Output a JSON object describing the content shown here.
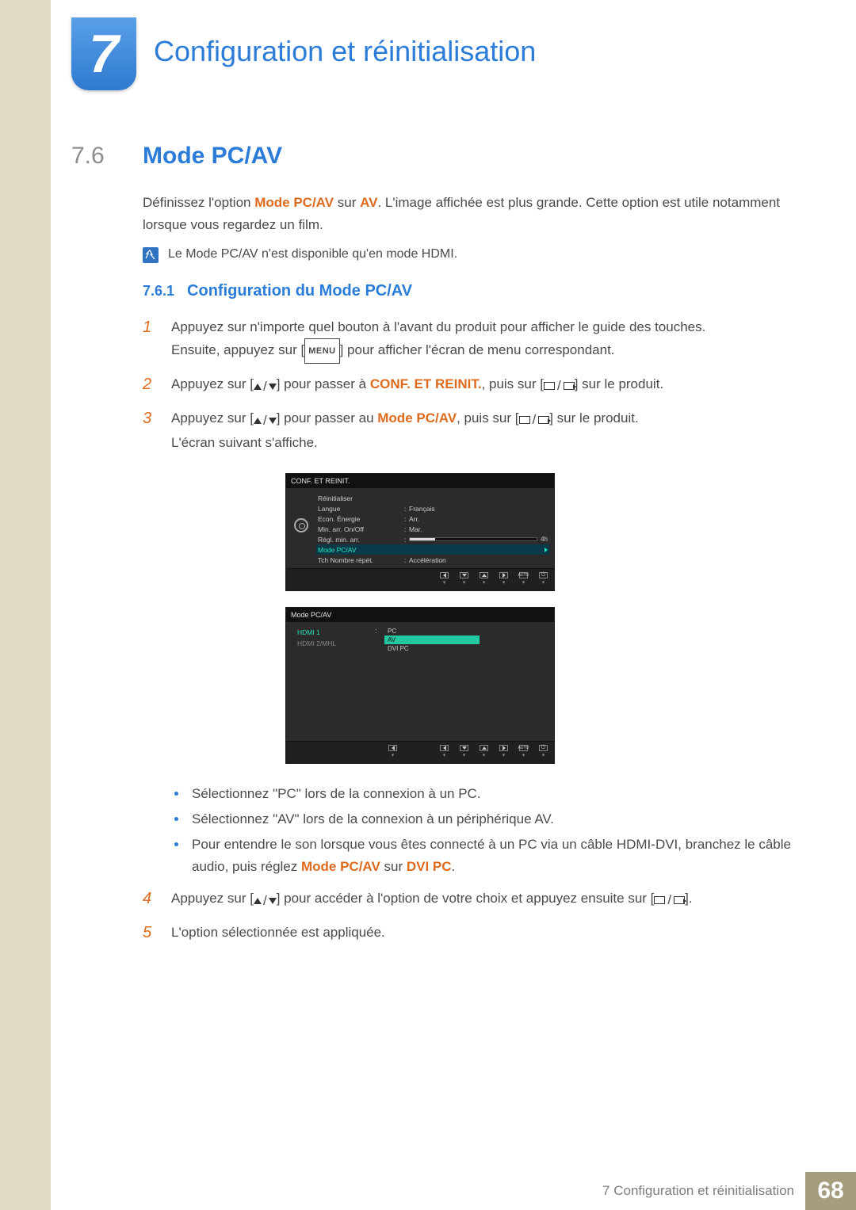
{
  "chapter": {
    "number": "7",
    "title": "Configuration et réinitialisation"
  },
  "section": {
    "number": "7.6",
    "title": "Mode PC/AV"
  },
  "para1": {
    "pre": "Définissez l'option ",
    "opt": "Mode PC/AV",
    "mid": " sur ",
    "val": "AV",
    "post": ". L'image affichée est plus grande. Cette option est utile notamment lorsque vous regardez un film."
  },
  "note1": {
    "pre": "Le ",
    "opt": "Mode PC/AV",
    "mid": " n'est disponible qu'en mode ",
    "val": "HDMI",
    "post": "."
  },
  "subsection": {
    "number": "7.6.1",
    "title": "Configuration du Mode PC/AV"
  },
  "steps": {
    "s1a": "Appuyez sur n'importe quel bouton à l'avant du produit pour afficher le guide des touches.",
    "s1b_pre": "Ensuite, appuyez sur [",
    "s1b_menu": "MENU",
    "s1b_post": "] pour afficher l'écran de menu correspondant.",
    "s2_pre": "Appuyez sur [",
    "s2_mid1": "] pour passer à ",
    "s2_conf": "CONF. ET REINIT.",
    "s2_mid2": ", puis sur [",
    "s2_post": "] sur le produit.",
    "s3_pre": "Appuyez sur [",
    "s3_mid1": "] pour passer au ",
    "s3_mode": "Mode PC/AV",
    "s3_mid2": ", puis sur [",
    "s3_post": "] sur le produit.",
    "s3_after": "L'écran suivant s'affiche.",
    "s4_pre": "Appuyez sur [",
    "s4_mid": "] pour accéder à l'option de votre choix et appuyez ensuite sur [",
    "s4_post": "].",
    "s5": "L'option sélectionnée est appliquée."
  },
  "bullets": {
    "b1": "Sélectionnez \"PC\" lors de la connexion à un PC.",
    "b2": "Sélectionnez \"AV\" lors de la connexion à un périphérique AV.",
    "b3_pre": "Pour entendre le son lorsque vous êtes connecté à un PC via un câble HDMI-DVI, branchez le câble audio, puis réglez ",
    "b3_mode": "Mode PC/AV",
    "b3_mid": " sur ",
    "b3_val": "DVI PC",
    "b3_post": "."
  },
  "osd1": {
    "title": "CONF. ET REINIT.",
    "rows": [
      {
        "lbl": "Réinitialiser",
        "val": ""
      },
      {
        "lbl": "Langue",
        "val": "Français"
      },
      {
        "lbl": "Econ. Énergie",
        "val": "Arr."
      },
      {
        "lbl": "Min. arr. On/Off",
        "val": "Mar."
      },
      {
        "lbl": "Régl. min. arr.",
        "slider": "4h"
      },
      {
        "lbl": "Mode PC/AV",
        "val": "",
        "hl": true
      },
      {
        "lbl": "Tch Nombre répét.",
        "val": "Accélération"
      }
    ],
    "nav_auto": "AUTO"
  },
  "osd2": {
    "title": "Mode PC/AV",
    "left": [
      {
        "name": "HDMI 1",
        "active": true
      },
      {
        "name": "HDMI 2/MHL",
        "active": false
      }
    ],
    "right": [
      {
        "name": "PC",
        "sel": false
      },
      {
        "name": "AV",
        "sel": true
      },
      {
        "name": "DVI PC",
        "sel": false
      }
    ],
    "nav_auto": "AUTO"
  },
  "footer": {
    "text_num": "7",
    "text_title": "Configuration et réinitialisation",
    "page": "68"
  }
}
